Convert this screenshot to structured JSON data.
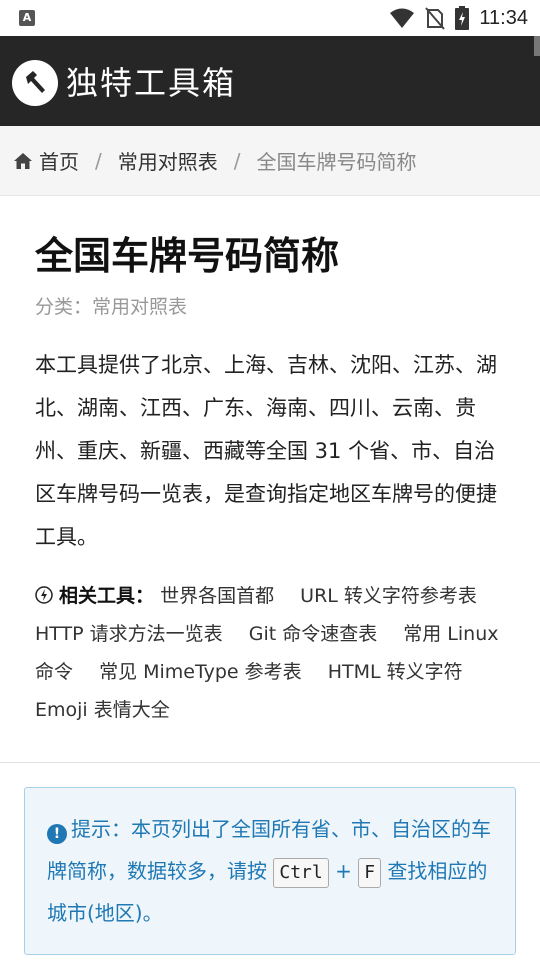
{
  "status_bar": {
    "left_icon": "A",
    "time": "11:34",
    "icons": [
      "wifi-icon",
      "no-sim-icon",
      "battery-charging-icon"
    ]
  },
  "app_bar": {
    "title": "独特工具箱",
    "logo_icon": "hammer-icon",
    "background": "#262626"
  },
  "breadcrumb": {
    "home": "首页",
    "section": "常用对照表",
    "current": "全国车牌号码简称",
    "separator": "/"
  },
  "page": {
    "title": "全国车牌号码简称",
    "category": "分类：常用对照表",
    "intro": "本工具提供了北京、上海、吉林、沈阳、江苏、湖北、湖南、江西、广东、海南、四川、云南、贵州、重庆、新疆、西藏等全国 31 个省、市、自治区车牌号码一览表，是查询指定地区车牌号的便捷工具。",
    "related_label": "相关工具：",
    "related_tools": [
      "世界各国首都",
      "URL 转义字符参考表",
      "HTTP 请求方法一览表",
      "Git 命令速查表",
      "常用 Linux 命令",
      "常见 MimeType 参考表",
      "HTML 转义字符",
      "Emoji 表情大全"
    ]
  },
  "notice": {
    "text_before": "提示：本页列出了全国所有省、市、自治区的车牌简称，数据较多，请按",
    "key1": "Ctrl",
    "plus": "+",
    "key2": "F",
    "text_after": "查找相应的城市(地区)。",
    "color": "#1f78b4"
  }
}
